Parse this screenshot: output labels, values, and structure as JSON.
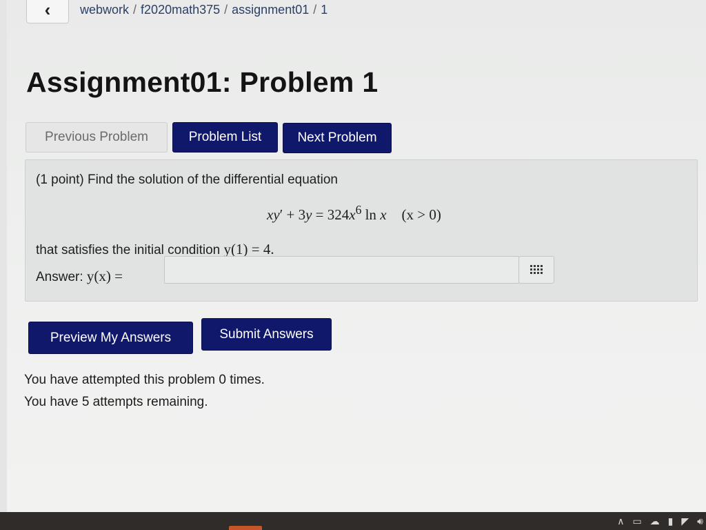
{
  "breadcrumb": {
    "items": [
      "webwork",
      "f2020math375",
      "assignment01",
      "1"
    ],
    "separator": "/"
  },
  "page_title": "Assignment01: Problem 1",
  "nav": {
    "previous": "Previous Problem",
    "list": "Problem List",
    "next": "Next Problem"
  },
  "problem": {
    "points": "(1 point)",
    "statement": "Find the solution of the differential equation",
    "equation": {
      "lhs_x": "x",
      "lhs_y": "y",
      "prime": "′",
      "plus": " + 3",
      "y2": "y",
      "equals": " = 324",
      "x2": "x",
      "exponent": "6",
      "ln": " ln ",
      "x3": "x",
      "condition": "(x > 0)"
    },
    "condition_prefix": "that satisfies the initial condition",
    "condition_math": "y(1) = 4.",
    "answer_label": "Answer:",
    "answer_math": "y(x) =",
    "answer_value": "",
    "palette_icon": "grid-icon"
  },
  "actions": {
    "preview": "Preview My Answers",
    "submit": "Submit Answers"
  },
  "attempts": {
    "made": "You have attempted this problem 0 times.",
    "remaining": "You have 5 attempts remaining."
  },
  "colors": {
    "primary_button": "#10186b",
    "disabled_button": "#e6e6e6",
    "problem_background": "#e1e2e2"
  }
}
